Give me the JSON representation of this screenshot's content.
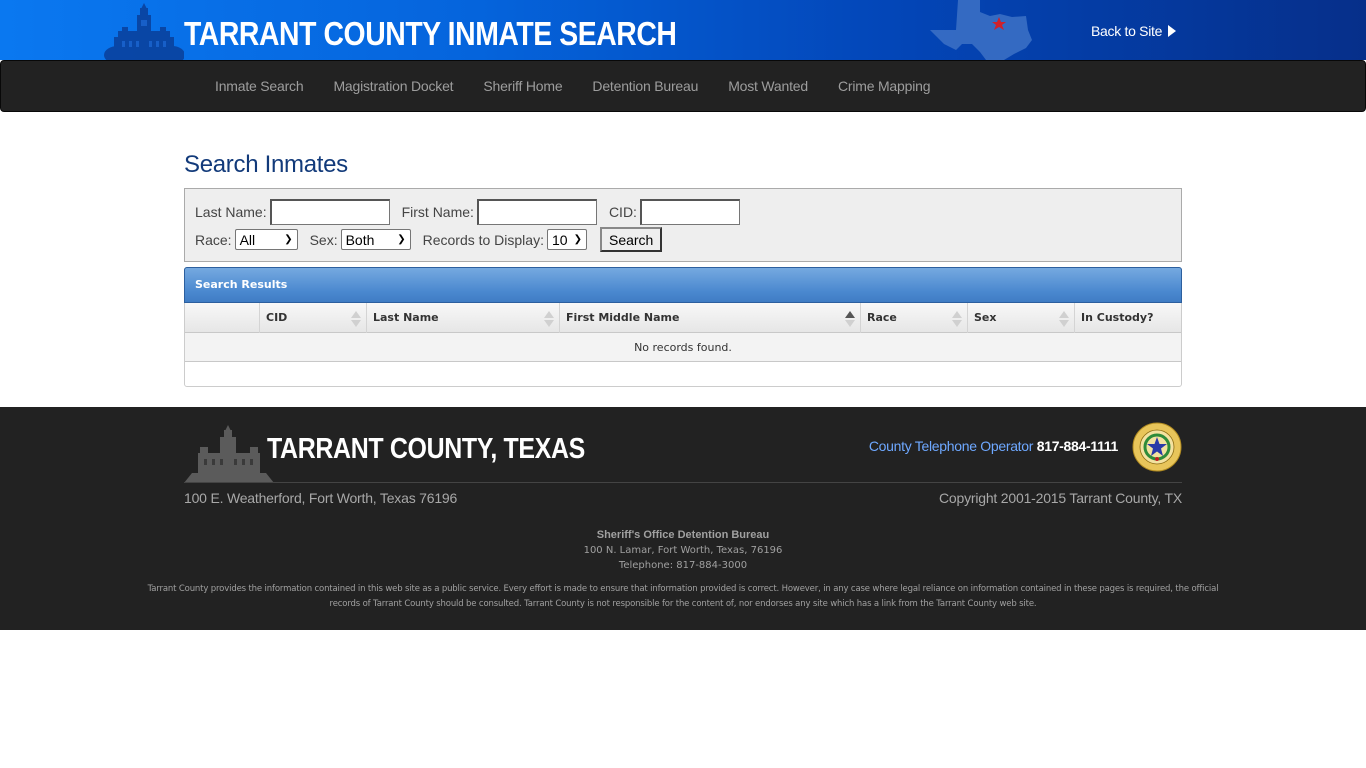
{
  "header": {
    "title": "TARRANT COUNTY INMATE SEARCH",
    "back_link": "Back to Site",
    "icons": {
      "logo": "courthouse-icon",
      "map": "texas-map-icon",
      "back": "play-arrow-icon"
    },
    "colors": {
      "gradient_start": "#0a78f0",
      "gradient_end": "#062f8a",
      "star": "#d0202a"
    }
  },
  "nav": {
    "items": [
      {
        "label": "Inmate Search"
      },
      {
        "label": "Magistration Docket"
      },
      {
        "label": "Sheriff Home"
      },
      {
        "label": "Detention Bureau"
      },
      {
        "label": "Most Wanted"
      },
      {
        "label": "Crime Mapping"
      }
    ]
  },
  "main": {
    "title": "Search Inmates",
    "form": {
      "last_name_label": "Last Name:",
      "last_name_value": "",
      "first_name_label": "First Name:",
      "first_name_value": "",
      "cid_label": "CID:",
      "cid_value": "",
      "race_label": "Race:",
      "race_selected": "All",
      "sex_label": "Sex:",
      "sex_selected": "Both",
      "records_label": "Records to Display:",
      "records_selected": "10",
      "search_button": "Search"
    },
    "results": {
      "title": "Search Results",
      "columns": [
        {
          "label": "",
          "sortable": false
        },
        {
          "label": "CID",
          "sortable": true,
          "sort": "none"
        },
        {
          "label": "Last Name",
          "sortable": true,
          "sort": "none"
        },
        {
          "label": "First Middle Name",
          "sortable": true,
          "sort": "ascending"
        },
        {
          "label": "Race",
          "sortable": true,
          "sort": "none"
        },
        {
          "label": "Sex",
          "sortable": true,
          "sort": "none"
        },
        {
          "label": "In Custody?",
          "sortable": false
        }
      ],
      "empty_message": "No records found.",
      "colors": {
        "header_bar": "#4a88cf"
      }
    }
  },
  "footer": {
    "title": "TARRANT COUNTY, TEXAS",
    "phone_label": "County Telephone Operator",
    "phone_number": "817-884-1111",
    "address": "100 E. Weatherford, Fort Worth, Texas 76196",
    "copyright": "Copyright 2001-2015 Tarrant County, TX",
    "bureau": {
      "name": "Sheriff's Office Detention Bureau",
      "address": "100 N. Lamar, Fort Worth, Texas, 76196",
      "telephone": "Telephone: 817-884-3000"
    },
    "disclaimer_line1": "Tarrant County provides the information contained in this web site as a public service. Every effort is made to ensure that information provided is correct. However, in any case where legal reliance on information contained in these pages is required, the official",
    "disclaimer_line2": "records of Tarrant County should be consulted. Tarrant County is not responsible for the content of, nor endorses any site which has a link from the Tarrant County web site.",
    "icons": {
      "building": "courthouse-icon",
      "seal": "county-seal-icon"
    },
    "colors": {
      "phone_label": "#6ea8ff",
      "background": "#222222"
    }
  }
}
